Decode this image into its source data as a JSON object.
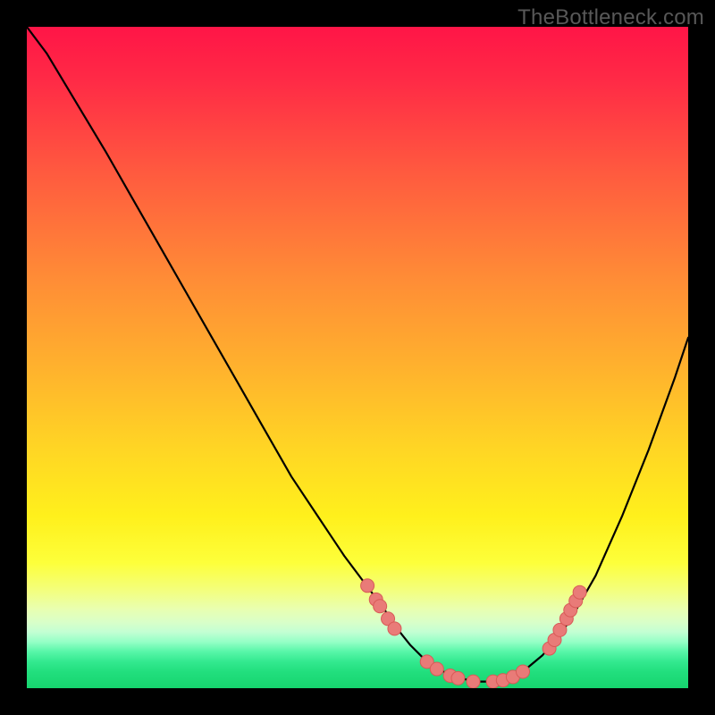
{
  "attribution": "TheBottleneck.com",
  "colors": {
    "frame": "#000000",
    "curve": "#000000",
    "dot_fill": "#e97b78",
    "dot_stroke": "#d85a57",
    "gradient_top": "#ff1547",
    "gradient_bottom": "#16d46e"
  },
  "chart_data": {
    "type": "line",
    "title": "",
    "xlabel": "",
    "ylabel": "",
    "xlim": [
      0,
      100
    ],
    "ylim": [
      0,
      100
    ],
    "legend": false,
    "grid": false,
    "series": [
      {
        "name": "bottleneck-curve",
        "x": [
          0,
          3,
          6,
          9,
          12,
          16,
          20,
          24,
          28,
          32,
          36,
          40,
          44,
          46,
          48,
          51,
          54,
          56,
          58,
          60,
          62,
          64,
          66,
          68,
          70,
          72,
          75,
          78,
          82,
          86,
          90,
          94,
          98,
          100
        ],
        "y": [
          100,
          96,
          91,
          86,
          81,
          74,
          67,
          60,
          53,
          46,
          39,
          32,
          26,
          23,
          20,
          16,
          12,
          9,
          6.5,
          4.5,
          3,
          2,
          1.4,
          1,
          1,
          1.3,
          2.5,
          5,
          10,
          17,
          26,
          36,
          47,
          53
        ]
      }
    ],
    "highlight_points": {
      "comment": "salmon dots near the trough region",
      "points": [
        {
          "x": 51.5,
          "y": 15.5
        },
        {
          "x": 52.8,
          "y": 13.4
        },
        {
          "x": 53.4,
          "y": 12.4
        },
        {
          "x": 54.6,
          "y": 10.5
        },
        {
          "x": 55.6,
          "y": 9.0
        },
        {
          "x": 60.5,
          "y": 4.0
        },
        {
          "x": 62.0,
          "y": 2.9
        },
        {
          "x": 64.0,
          "y": 1.9
        },
        {
          "x": 65.2,
          "y": 1.5
        },
        {
          "x": 67.5,
          "y": 1.0
        },
        {
          "x": 70.5,
          "y": 1.0
        },
        {
          "x": 72.0,
          "y": 1.2
        },
        {
          "x": 73.5,
          "y": 1.7
        },
        {
          "x": 75.0,
          "y": 2.5
        },
        {
          "x": 79.0,
          "y": 6.0
        },
        {
          "x": 79.8,
          "y": 7.3
        },
        {
          "x": 80.6,
          "y": 8.8
        },
        {
          "x": 81.6,
          "y": 10.5
        },
        {
          "x": 82.2,
          "y": 11.8
        },
        {
          "x": 83.0,
          "y": 13.2
        },
        {
          "x": 83.6,
          "y": 14.5
        }
      ]
    }
  }
}
